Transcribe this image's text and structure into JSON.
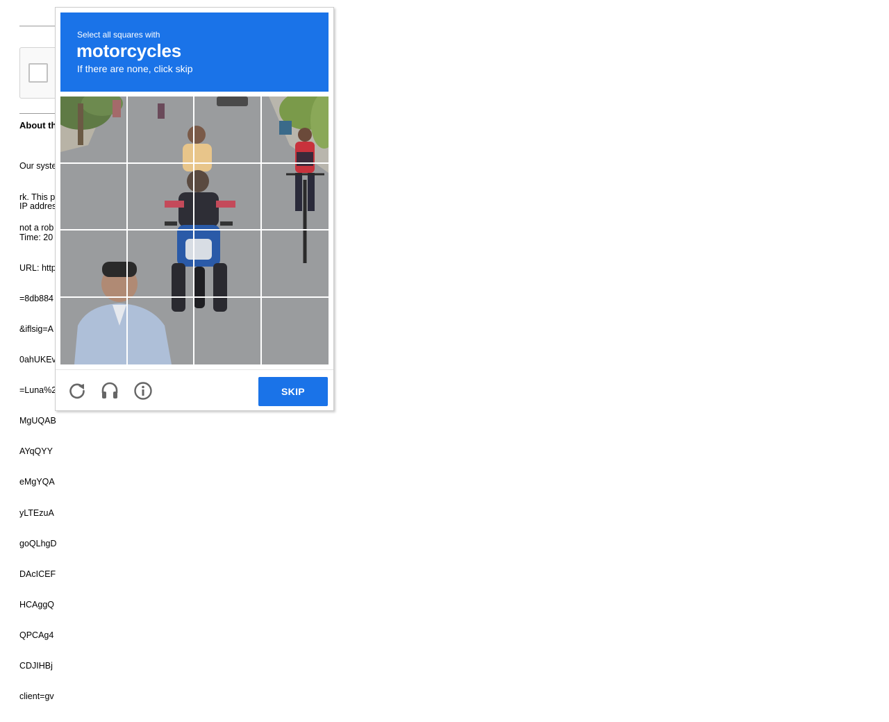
{
  "background": {
    "heading": "About th",
    "paragraph1": [
      "Our syste",
      "rk. This p",
      "not a rob"
    ],
    "paragraph2": [
      "IP addres",
      "Time: 20",
      "URL: http",
      "=8db884",
      "&iflsig=A",
      "0ahUKEv",
      "=Luna%2",
      "MgUQAB",
      "AYqQYY",
      "eMgYQA",
      "yLTEzuA",
      "goQLhgD",
      "DAcICEF",
      "HCAggQ",
      "QPCAg4",
      "CDJIHBj",
      "client=gv"
    ]
  },
  "challenge": {
    "instruction_small": "Select all squares with",
    "target": "motorcycles",
    "instruction_sub": "If there are none, click skip",
    "grid_size": 4,
    "skip_label": "SKIP",
    "icons": [
      "reload-icon",
      "audio-icon",
      "info-icon"
    ],
    "accent_color": "#1a73e8"
  }
}
